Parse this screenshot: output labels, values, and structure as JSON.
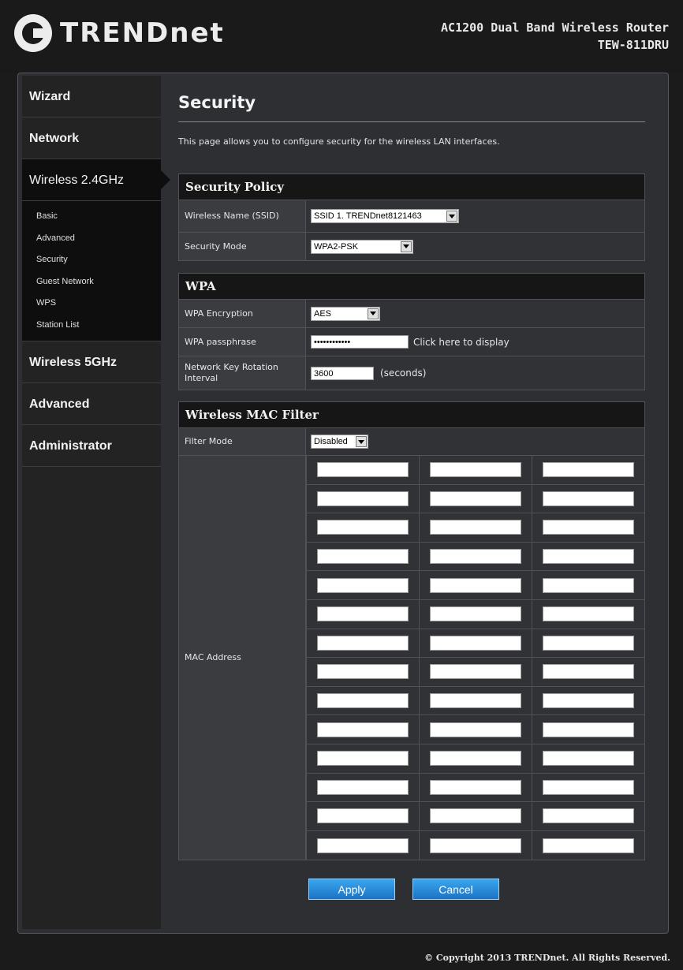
{
  "header": {
    "logo_text": "TRENDnet",
    "product_line1": "AC1200 Dual Band Wireless Router",
    "product_line2": "TEW-811DRU"
  },
  "sidebar": {
    "items": [
      {
        "label": "Wizard"
      },
      {
        "label": "Network"
      },
      {
        "label": "Wireless 2.4GHz",
        "active": true
      },
      {
        "label": "Wireless 5GHz"
      },
      {
        "label": "Advanced"
      },
      {
        "label": "Administrator"
      }
    ],
    "subitems": [
      "Basic",
      "Advanced",
      "Security",
      "Guest Network",
      "WPS",
      "Station List"
    ]
  },
  "page": {
    "title": "Security",
    "description": "This page allows you to configure security for the wireless LAN interfaces."
  },
  "security_policy": {
    "heading": "Security Policy",
    "ssid_label": "Wireless Name (SSID)",
    "ssid_value": "SSID 1. TRENDnet8121463",
    "mode_label": "Security Mode",
    "mode_value": "WPA2-PSK"
  },
  "wpa": {
    "heading": "WPA",
    "encryption_label": "WPA Encryption",
    "encryption_value": "AES",
    "passphrase_label": "WPA passphrase",
    "passphrase_value": "••••••••••••",
    "display_link": "Click here to display",
    "rotation_label": "Network Key Rotation Interval",
    "rotation_value": "3600",
    "rotation_unit": "(seconds)"
  },
  "mac_filter": {
    "heading": "Wireless MAC Filter",
    "filter_mode_label": "Filter Mode",
    "filter_mode_value": "Disabled",
    "mac_label": "MAC Address",
    "rows": 14,
    "cols": 3
  },
  "buttons": {
    "apply": "Apply",
    "cancel": "Cancel"
  },
  "footer": {
    "copyright": "© Copyright 2013 TRENDnet. All Rights Reserved."
  }
}
